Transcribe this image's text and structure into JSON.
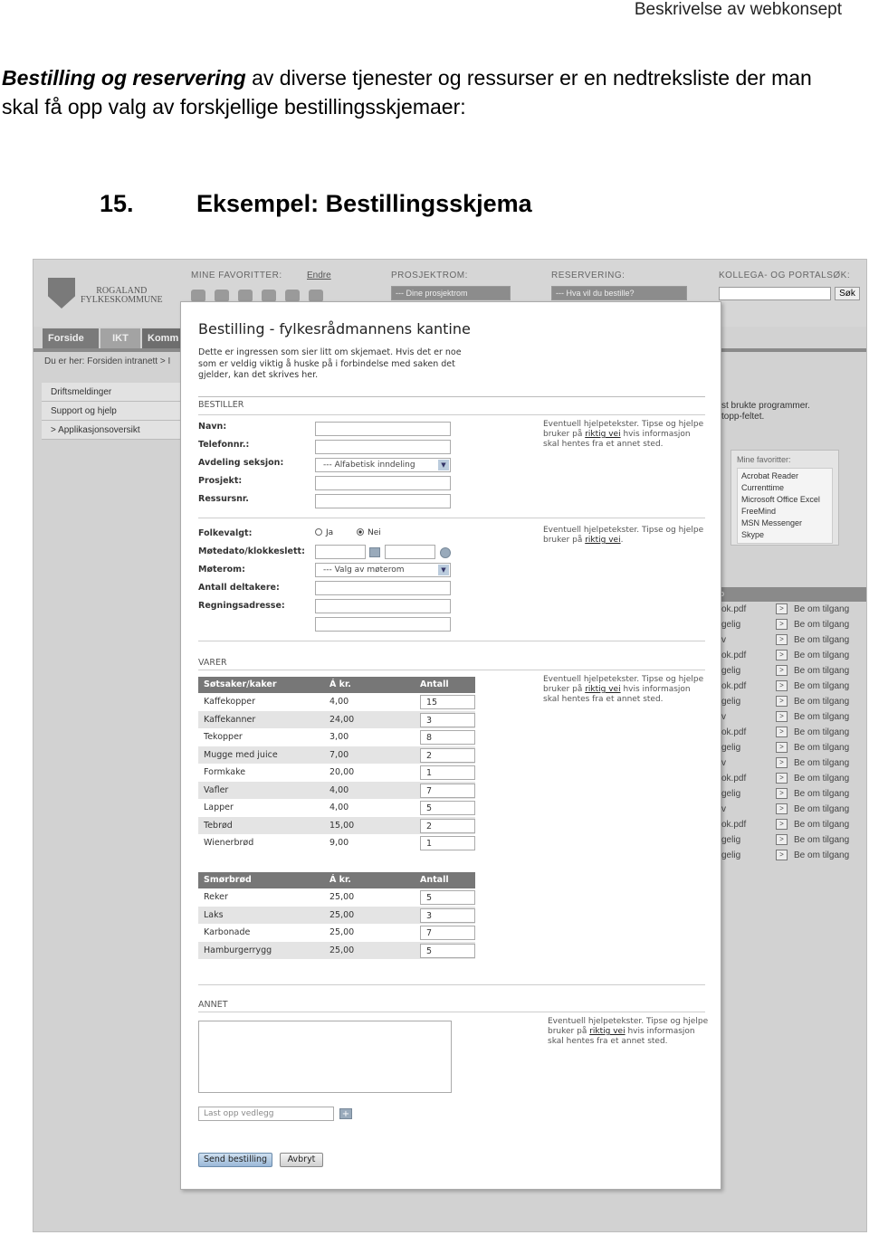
{
  "doc": {
    "header": "Beskrivelse av webkonsept",
    "intro_bold": "Bestilling og reservering",
    "intro_rest": " av diverse tjenester og ressurser er en nedtreksliste der man skal få opp valg av forskjellige bestillingsskjemaer:",
    "section_number": "15.",
    "section_title": "Eksempel: Bestillingsskjema"
  },
  "portal": {
    "logo_line1": "ROGALAND",
    "logo_line2": "FYLKESKOMMUNE",
    "favorites_label": "MINE FAVORITTER:",
    "favorites_edit": "Endre",
    "projects_label": "PROSJEKTROM:",
    "projects_select": "--- Dine prosjektrom",
    "reservation_label": "RESERVERING:",
    "reservation_select": "--- Hva vil du bestille?",
    "search_label": "KOLLEGA- OG PORTALSØK:",
    "search_button": "Søk",
    "nav_tabs": [
      "Forside",
      "IKT",
      "Komm"
    ],
    "breadcrumb": "Du er her: Forsiden intranett > I",
    "side_menu": [
      "Driftsmeldinger",
      "Support og hjelp",
      "> Applikasjonsoversikt"
    ],
    "right_text_1": "st brukte programmer.",
    "right_text_2": "topp-feltet.",
    "my_favorites_label": "Mine favoritter:",
    "my_favorites": [
      "Acrobat Reader",
      "Currenttime",
      "Microsoft Office Excel",
      "FreeMind",
      "MSN Messenger",
      "Skype"
    ],
    "list_header": "p",
    "list_rows": [
      {
        "file": "ok.pdf",
        "action": "Be om tilgang"
      },
      {
        "file": "gelig",
        "action": "Be om tilgang"
      },
      {
        "file": "v",
        "action": "Be om tilgang"
      },
      {
        "file": "ok.pdf",
        "action": "Be om tilgang"
      },
      {
        "file": "gelig",
        "action": "Be om tilgang"
      },
      {
        "file": "ok.pdf",
        "action": "Be om tilgang"
      },
      {
        "file": "gelig",
        "action": "Be om tilgang"
      },
      {
        "file": "v",
        "action": "Be om tilgang"
      },
      {
        "file": "ok.pdf",
        "action": "Be om tilgang"
      },
      {
        "file": "gelig",
        "action": "Be om tilgang"
      },
      {
        "file": "v",
        "action": "Be om tilgang"
      },
      {
        "file": "ok.pdf",
        "action": "Be om tilgang"
      },
      {
        "file": "gelig",
        "action": "Be om tilgang"
      },
      {
        "file": "v",
        "action": "Be om tilgang"
      },
      {
        "file": "ok.pdf",
        "action": "Be om tilgang"
      },
      {
        "file": "gelig",
        "action": "Be om tilgang"
      },
      {
        "file": "gelig",
        "action": "Be om tilgang"
      }
    ]
  },
  "form": {
    "title": "Bestilling - fylkesrådmannens kantine",
    "intro": "Dette er ingressen som sier litt om skjemaet. Hvis det er noe som er veldig viktig å huske på i forbindelse med saken det gjelder, kan det skrives her.",
    "section_orderer": "BESTILLER",
    "labels": {
      "name": "Navn:",
      "phone": "Telefonnr.:",
      "department": "Avdeling seksjon:",
      "project": "Prosjekt:",
      "resource": "Ressursnr.",
      "elected": "Folkevalgt:",
      "meeting_date": "Møtedato/klokkeslett:",
      "meeting_room": "Møterom:",
      "participants": "Antall deltakere:",
      "billing": "Regningsadresse:"
    },
    "department_select": "--- Alfabetisk inndeling",
    "room_select": "--- Valg av møterom",
    "radio_yes": "Ja",
    "radio_no": "Nei",
    "help_1_a": "Eventuell hjelpetekster. Tipse og hjelpe bruker på ",
    "help_1_link": "riktig vei",
    "help_1_b": " hvis informasjon skal hentes fra et annet sted.",
    "help_2_a": "Eventuell hjelpetekster. Tipse og hjelpe bruker på ",
    "help_2_link": "riktig vei",
    "help_2_b": ".",
    "help_3_a": "Eventuell hjelpetekster. Tipse og hjelpe bruker på ",
    "help_3_link": "riktig vei",
    "help_3_b": " hvis informasjon skal hentes fra et annet sted.",
    "help_4_a": "Eventuell hjelpetekster. Tipse og hjelpe bruker på ",
    "help_4_link": "riktig vei",
    "help_4_b": " hvis informasjon skal hentes fra et annet sted.",
    "section_goods": "VARER",
    "sweets_table": {
      "headers": [
        "Søtsaker/kaker",
        "Á kr.",
        "Antall"
      ],
      "rows": [
        {
          "item": "Kaffekopper",
          "price": "4,00",
          "qty": "15"
        },
        {
          "item": "Kaffekanner",
          "price": "24,00",
          "qty": "3"
        },
        {
          "item": "Tekopper",
          "price": "3,00",
          "qty": "8"
        },
        {
          "item": "Mugge med juice",
          "price": "7,00",
          "qty": "2"
        },
        {
          "item": "Formkake",
          "price": "20,00",
          "qty": "1"
        },
        {
          "item": "Vafler",
          "price": "4,00",
          "qty": "7"
        },
        {
          "item": "Lapper",
          "price": "4,00",
          "qty": "5"
        },
        {
          "item": "Tebrød",
          "price": "15,00",
          "qty": "2"
        },
        {
          "item": "Wienerbrød",
          "price": "9,00",
          "qty": "1"
        }
      ]
    },
    "sandwich_table": {
      "headers": [
        "Smørbrød",
        "Á kr.",
        "Antall"
      ],
      "rows": [
        {
          "item": "Reker",
          "price": "25,00",
          "qty": "5"
        },
        {
          "item": "Laks",
          "price": "25,00",
          "qty": "3"
        },
        {
          "item": "Karbonade",
          "price": "25,00",
          "qty": "7"
        },
        {
          "item": "Hamburgerrygg",
          "price": "25,00",
          "qty": "5"
        }
      ]
    },
    "section_other": "ANNET",
    "upload_placeholder": "Last opp vedlegg",
    "submit_label": "Send bestilling",
    "cancel_label": "Avbryt"
  }
}
